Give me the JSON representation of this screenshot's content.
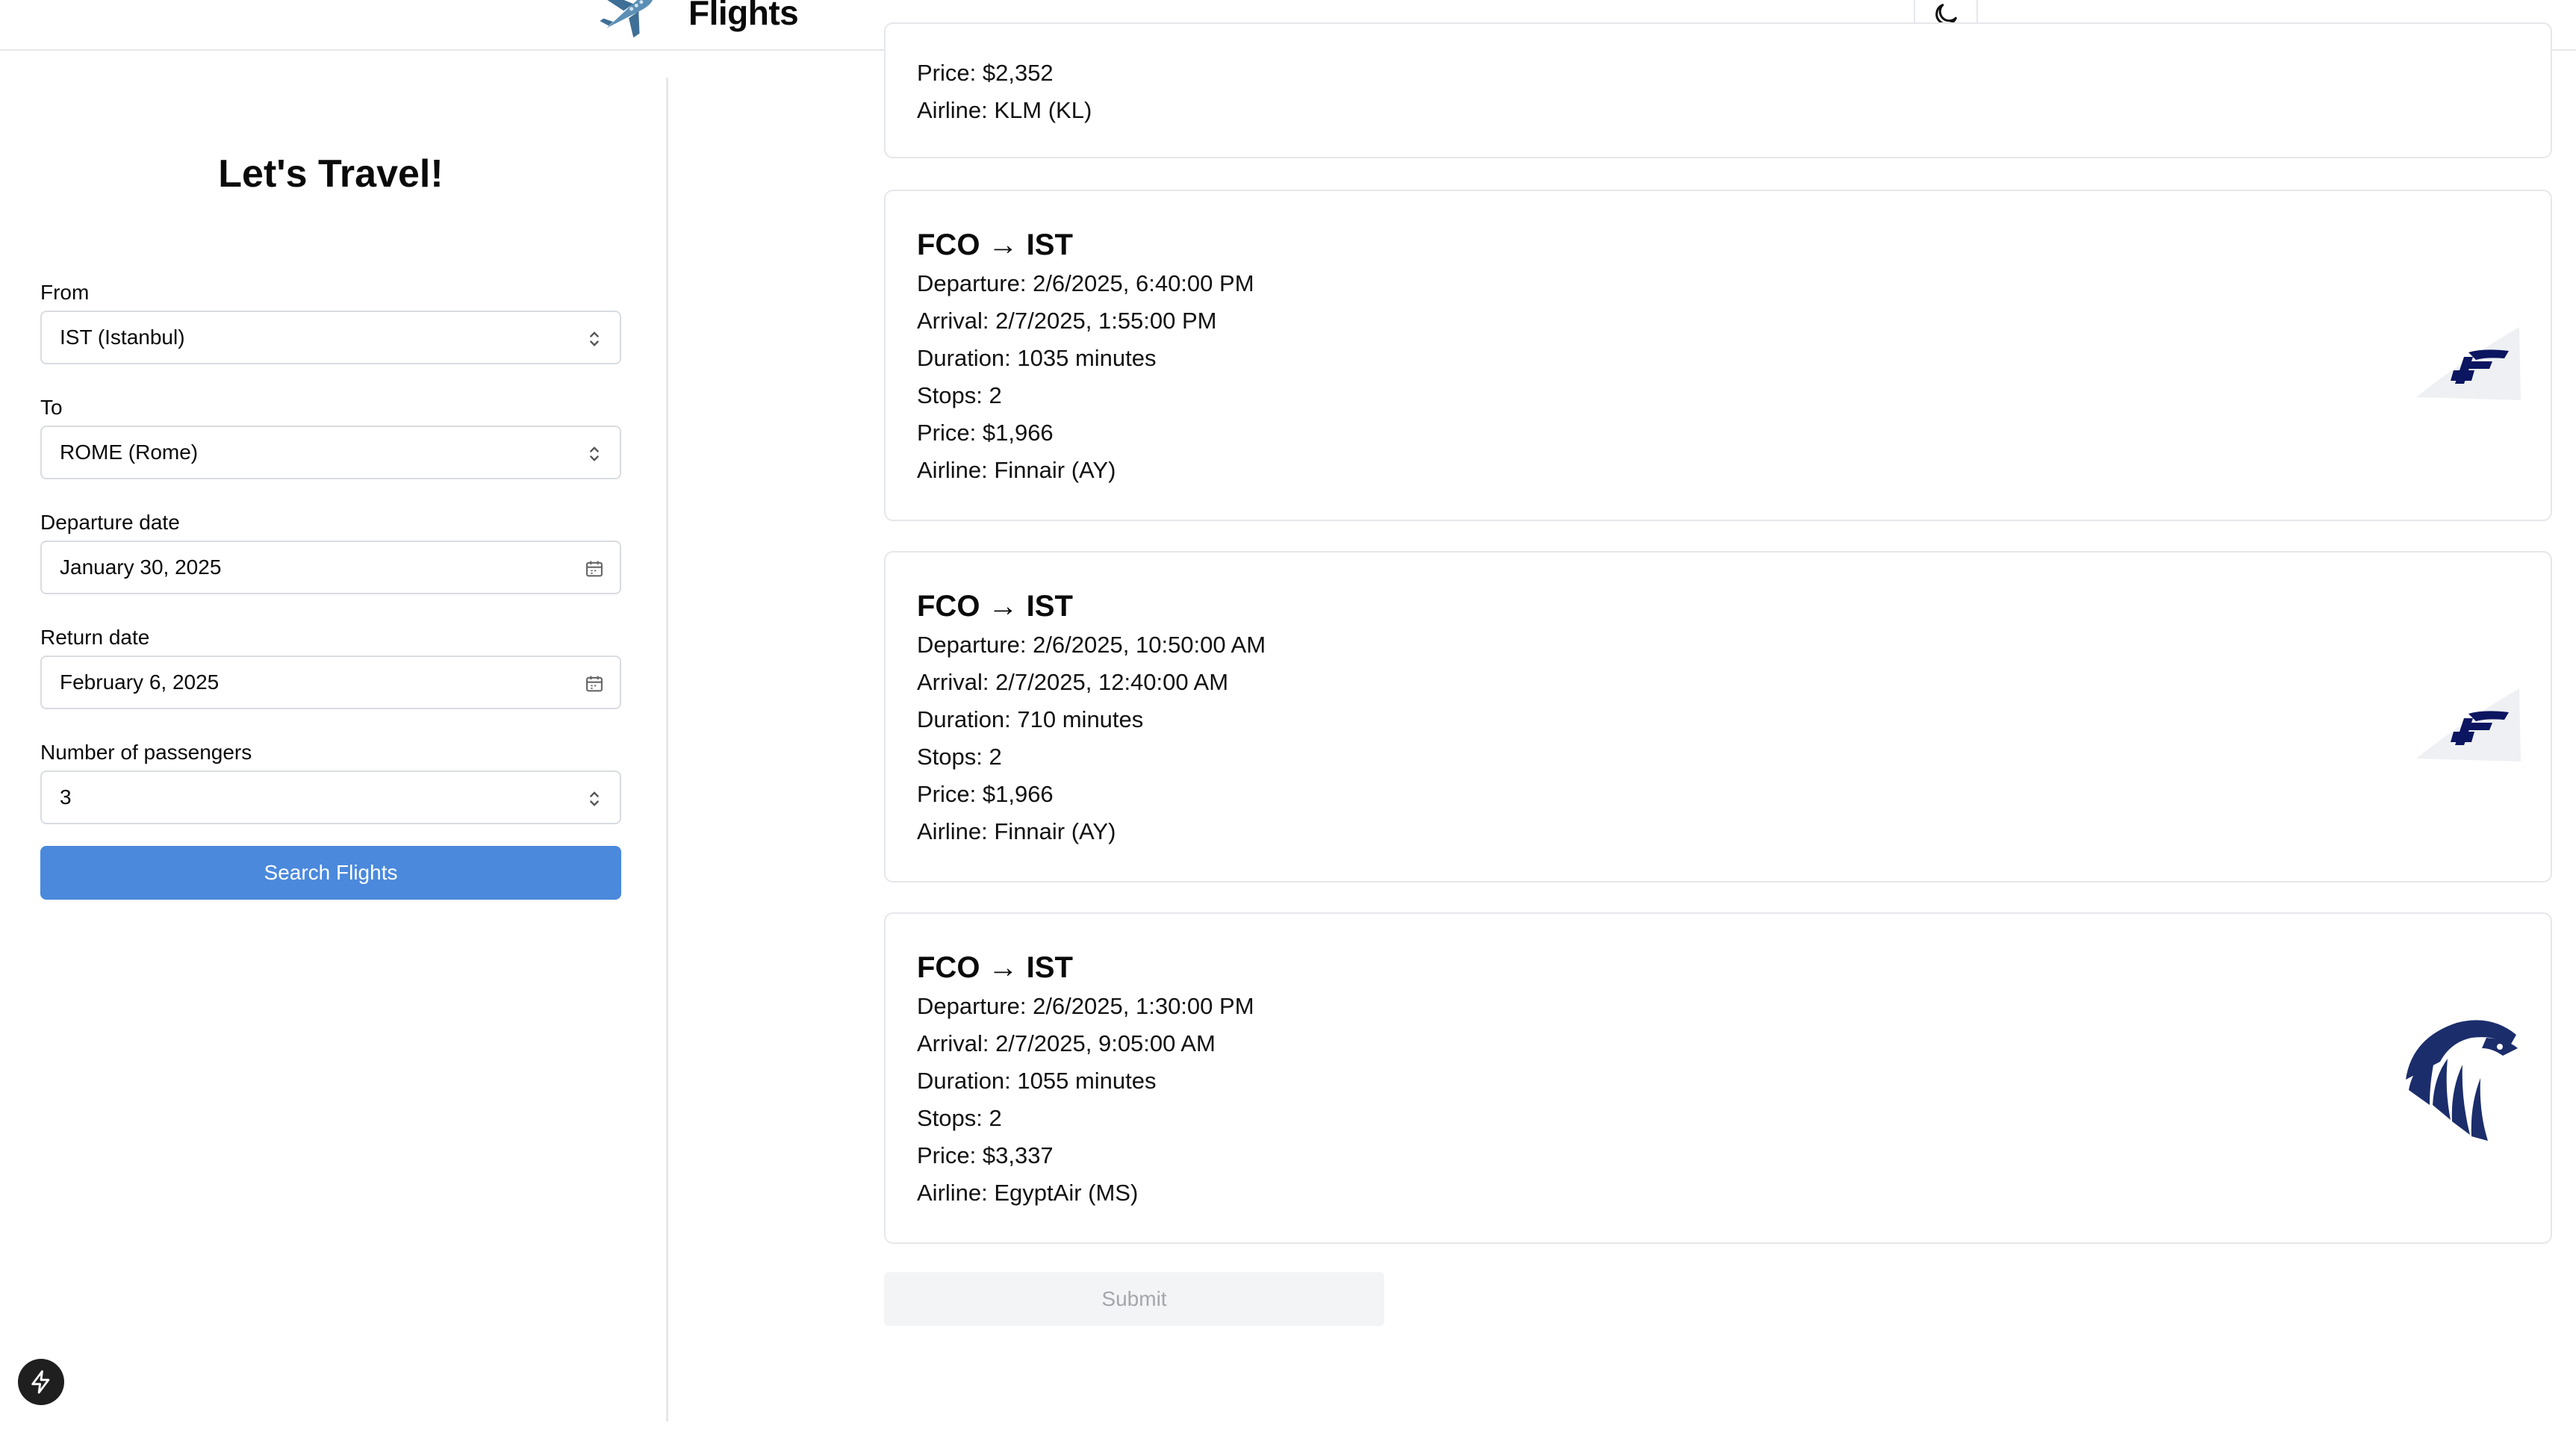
{
  "header": {
    "title": "Flights",
    "logo_icon": "airplane-icon",
    "theme_toggle_icon": "moon-icon"
  },
  "sidebar": {
    "title": "Let's Travel!",
    "from": {
      "label": "From",
      "value": "IST (Istanbul)"
    },
    "to": {
      "label": "To",
      "value": "ROME (Rome)"
    },
    "departure": {
      "label": "Departure date",
      "value": "January 30, 2025"
    },
    "return": {
      "label": "Return date",
      "value": "February 6, 2025"
    },
    "passengers": {
      "label": "Number of passengers",
      "value": "3"
    },
    "search_label": "Search Flights"
  },
  "results": {
    "cards": [
      {
        "price": "Price: $2,352",
        "airline": "Airline: KLM (KL)"
      },
      {
        "route": "FCO → IST",
        "departure": "Departure: 2/6/2025, 6:40:00 PM",
        "arrival": "Arrival: 2/7/2025, 1:55:00 PM",
        "duration": "Duration: 1035 minutes",
        "stops": "Stops: 2",
        "price": "Price: $1,966",
        "airline": "Airline: Finnair (AY)",
        "logo": "finnair-logo"
      },
      {
        "route": "FCO → IST",
        "departure": "Departure: 2/6/2025, 10:50:00 AM",
        "arrival": "Arrival: 2/7/2025, 12:40:00 AM",
        "duration": "Duration: 710 minutes",
        "stops": "Stops: 2",
        "price": "Price: $1,966",
        "airline": "Airline: Finnair (AY)",
        "logo": "finnair-logo"
      },
      {
        "route": "FCO → IST",
        "departure": "Departure: 2/6/2025, 1:30:00 PM",
        "arrival": "Arrival: 2/7/2025, 9:05:00 AM",
        "duration": "Duration: 1055 minutes",
        "stops": "Stops: 2",
        "price": "Price: $3,337",
        "airline": "Airline: EgyptAir (MS)",
        "logo": "egyptair-logo"
      }
    ],
    "submit_label": "Submit"
  },
  "colors": {
    "primary_button": "#4a89dc",
    "finnair_blue": "#0b1560",
    "egyptair_blue": "#1b2d6b"
  }
}
